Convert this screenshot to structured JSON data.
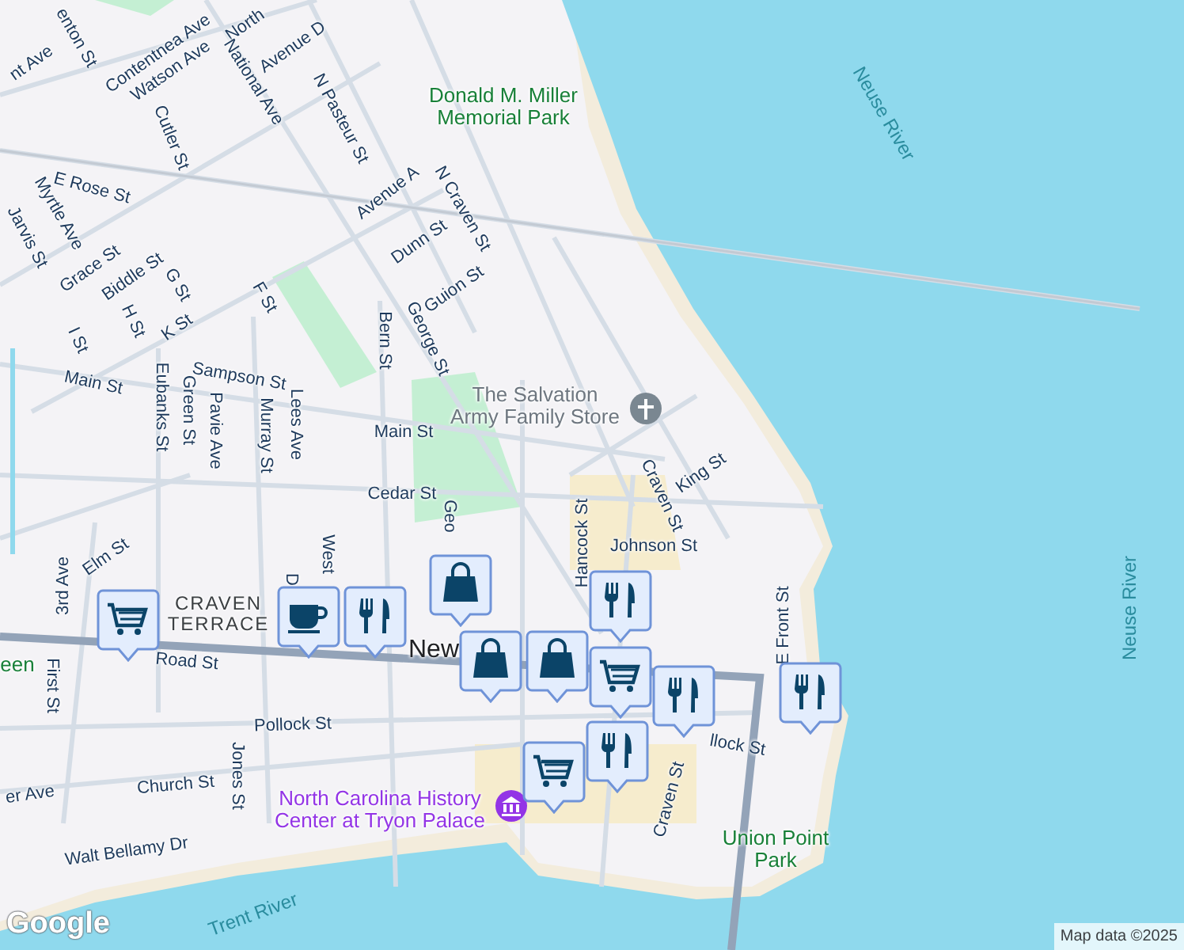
{
  "map": {
    "labels": [
      {
        "text": "enton St",
        "kind": "street"
      },
      {
        "text": "Contentnea Ave",
        "kind": "street"
      },
      {
        "text": "North",
        "kind": "street"
      },
      {
        "text": "nt Ave",
        "kind": "street"
      },
      {
        "text": "Watson Ave",
        "kind": "street"
      },
      {
        "text": "Avenue D",
        "kind": "street"
      },
      {
        "text": "National Ave",
        "kind": "street"
      },
      {
        "text": "Donald M. Miller Memorial Park",
        "kind": "park"
      },
      {
        "text": "Neuse River",
        "kind": "water"
      },
      {
        "text": "N Pasteur St",
        "kind": "street"
      },
      {
        "text": "Cutler St",
        "kind": "street"
      },
      {
        "text": "E Rose St",
        "kind": "street"
      },
      {
        "text": "Avenue A",
        "kind": "street"
      },
      {
        "text": "N Craven St",
        "kind": "street"
      },
      {
        "text": "Myrtle Ave",
        "kind": "street"
      },
      {
        "text": "Jarvis St",
        "kind": "street"
      },
      {
        "text": "Dunn St",
        "kind": "street"
      },
      {
        "text": "Grace St",
        "kind": "street"
      },
      {
        "text": "Biddle St",
        "kind": "street"
      },
      {
        "text": "G St",
        "kind": "street"
      },
      {
        "text": "Guion St",
        "kind": "street"
      },
      {
        "text": "F St",
        "kind": "street"
      },
      {
        "text": "H St",
        "kind": "street"
      },
      {
        "text": "K St",
        "kind": "street"
      },
      {
        "text": "Bern St",
        "kind": "street"
      },
      {
        "text": "George St",
        "kind": "street"
      },
      {
        "text": "I St",
        "kind": "street"
      },
      {
        "text": "Sampson St",
        "kind": "street"
      },
      {
        "text": "Main St",
        "kind": "street"
      },
      {
        "text": "The Salvation Army Family Store",
        "kind": "poi"
      },
      {
        "text": "Eubanks St",
        "kind": "street"
      },
      {
        "text": "Green St",
        "kind": "street"
      },
      {
        "text": "Pavie Ave",
        "kind": "street"
      },
      {
        "text": "Main St",
        "kind": "street"
      },
      {
        "text": "Murray St",
        "kind": "street"
      },
      {
        "text": "Lees Ave",
        "kind": "street"
      },
      {
        "text": "King St",
        "kind": "street"
      },
      {
        "text": "Cedar St",
        "kind": "street"
      },
      {
        "text": "Craven St",
        "kind": "street"
      },
      {
        "text": "Hancock St",
        "kind": "street"
      },
      {
        "text": "Johnson St",
        "kind": "street"
      },
      {
        "text": "Neuse River",
        "kind": "water"
      },
      {
        "text": "Geo",
        "kind": "street"
      },
      {
        "text": "Elm St",
        "kind": "street"
      },
      {
        "text": "3rd Ave",
        "kind": "street"
      },
      {
        "text": "D",
        "kind": "street"
      },
      {
        "text": "CRAVEN TERRACE",
        "kind": "district"
      },
      {
        "text": "West",
        "kind": "street"
      },
      {
        "text": "E Front St",
        "kind": "street"
      },
      {
        "text": "New",
        "kind": "city"
      },
      {
        "text": "Road St",
        "kind": "street"
      },
      {
        "text": "een",
        "kind": "park"
      },
      {
        "text": "First St",
        "kind": "street"
      },
      {
        "text": "Pollock St",
        "kind": "street"
      },
      {
        "text": "llock St",
        "kind": "street"
      },
      {
        "text": "Jones St",
        "kind": "street"
      },
      {
        "text": "Church St",
        "kind": "street"
      },
      {
        "text": "er Ave",
        "kind": "street"
      },
      {
        "text": "Craven St",
        "kind": "street"
      },
      {
        "text": "North Carolina History Center at Tryon Palace",
        "kind": "museum"
      },
      {
        "text": "Walt Bellamy Dr",
        "kind": "street"
      },
      {
        "text": "Union Point Park",
        "kind": "park"
      },
      {
        "text": "Trent River",
        "kind": "water"
      }
    ],
    "markers": [
      {
        "kind": "cart"
      },
      {
        "kind": "cup"
      },
      {
        "kind": "cutlery"
      },
      {
        "kind": "bag"
      },
      {
        "kind": "bag"
      },
      {
        "kind": "bag"
      },
      {
        "kind": "cutlery"
      },
      {
        "kind": "cart"
      },
      {
        "kind": "cutlery"
      },
      {
        "kind": "cutlery"
      },
      {
        "kind": "cart"
      },
      {
        "kind": "cutlery"
      }
    ],
    "logo": "Google",
    "attribution": "Map data ©2025"
  }
}
